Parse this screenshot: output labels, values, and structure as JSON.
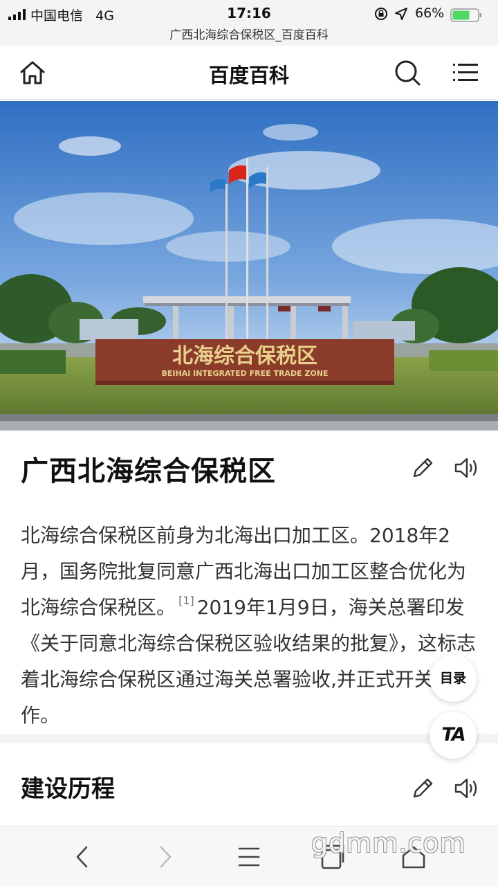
{
  "status_bar": {
    "carrier": "中国电信",
    "network": "4G",
    "time": "17:16",
    "battery": "66%",
    "page_title": "广西北海综合保税区_百度百科"
  },
  "navbar": {
    "title": "百度百科"
  },
  "hero": {
    "sign_cn": "北海综合保税区",
    "sign_en": "BEIHAI INTEGRATED FREE TRADE ZONE"
  },
  "entry": {
    "title": "广西北海综合保税区",
    "summary_part1": "北海综合保税区前身为北海出口加工区。2018年2月，国务院批复同意广西北海出口加工区整合优化为北海综合保税区。",
    "citation": "[1]",
    "summary_part2": "2019年1月9日，海关总署印发《关于同意北海综合保税区验收结果的批复》，这标志着北海综合保税区通过海关总署验收,并正式开关运作。"
  },
  "section": {
    "title": "建设历程"
  },
  "floating": {
    "toc_label": "目录",
    "ta_label": "TA"
  },
  "watermark": "gdmm.com",
  "colors": {
    "sky": "#3a78c8",
    "sign": "#8a3b2a",
    "battery": "#4cd964"
  }
}
